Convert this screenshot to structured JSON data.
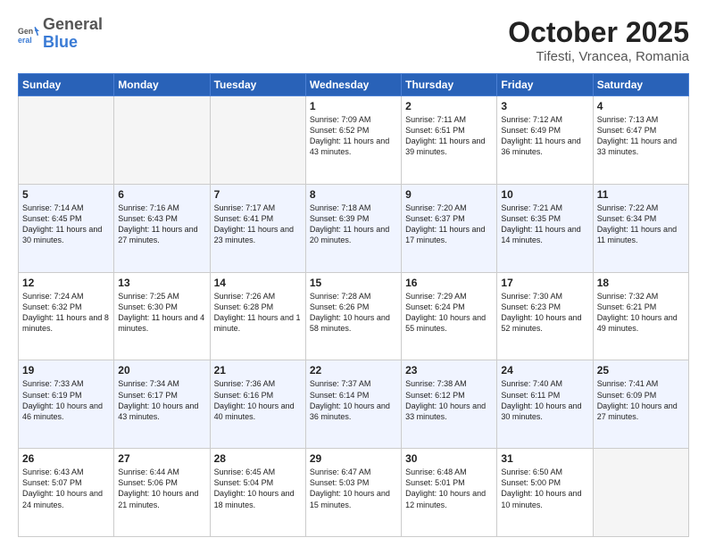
{
  "logo": {
    "general": "General",
    "blue": "Blue"
  },
  "header": {
    "month": "October 2025",
    "location": "Tifesti, Vrancea, Romania"
  },
  "weekdays": [
    "Sunday",
    "Monday",
    "Tuesday",
    "Wednesday",
    "Thursday",
    "Friday",
    "Saturday"
  ],
  "weeks": [
    [
      {
        "day": "",
        "info": ""
      },
      {
        "day": "",
        "info": ""
      },
      {
        "day": "",
        "info": ""
      },
      {
        "day": "1",
        "info": "Sunrise: 7:09 AM\nSunset: 6:52 PM\nDaylight: 11 hours and 43 minutes."
      },
      {
        "day": "2",
        "info": "Sunrise: 7:11 AM\nSunset: 6:51 PM\nDaylight: 11 hours and 39 minutes."
      },
      {
        "day": "3",
        "info": "Sunrise: 7:12 AM\nSunset: 6:49 PM\nDaylight: 11 hours and 36 minutes."
      },
      {
        "day": "4",
        "info": "Sunrise: 7:13 AM\nSunset: 6:47 PM\nDaylight: 11 hours and 33 minutes."
      }
    ],
    [
      {
        "day": "5",
        "info": "Sunrise: 7:14 AM\nSunset: 6:45 PM\nDaylight: 11 hours and 30 minutes."
      },
      {
        "day": "6",
        "info": "Sunrise: 7:16 AM\nSunset: 6:43 PM\nDaylight: 11 hours and 27 minutes."
      },
      {
        "day": "7",
        "info": "Sunrise: 7:17 AM\nSunset: 6:41 PM\nDaylight: 11 hours and 23 minutes."
      },
      {
        "day": "8",
        "info": "Sunrise: 7:18 AM\nSunset: 6:39 PM\nDaylight: 11 hours and 20 minutes."
      },
      {
        "day": "9",
        "info": "Sunrise: 7:20 AM\nSunset: 6:37 PM\nDaylight: 11 hours and 17 minutes."
      },
      {
        "day": "10",
        "info": "Sunrise: 7:21 AM\nSunset: 6:35 PM\nDaylight: 11 hours and 14 minutes."
      },
      {
        "day": "11",
        "info": "Sunrise: 7:22 AM\nSunset: 6:34 PM\nDaylight: 11 hours and 11 minutes."
      }
    ],
    [
      {
        "day": "12",
        "info": "Sunrise: 7:24 AM\nSunset: 6:32 PM\nDaylight: 11 hours and 8 minutes."
      },
      {
        "day": "13",
        "info": "Sunrise: 7:25 AM\nSunset: 6:30 PM\nDaylight: 11 hours and 4 minutes."
      },
      {
        "day": "14",
        "info": "Sunrise: 7:26 AM\nSunset: 6:28 PM\nDaylight: 11 hours and 1 minute."
      },
      {
        "day": "15",
        "info": "Sunrise: 7:28 AM\nSunset: 6:26 PM\nDaylight: 10 hours and 58 minutes."
      },
      {
        "day": "16",
        "info": "Sunrise: 7:29 AM\nSunset: 6:24 PM\nDaylight: 10 hours and 55 minutes."
      },
      {
        "day": "17",
        "info": "Sunrise: 7:30 AM\nSunset: 6:23 PM\nDaylight: 10 hours and 52 minutes."
      },
      {
        "day": "18",
        "info": "Sunrise: 7:32 AM\nSunset: 6:21 PM\nDaylight: 10 hours and 49 minutes."
      }
    ],
    [
      {
        "day": "19",
        "info": "Sunrise: 7:33 AM\nSunset: 6:19 PM\nDaylight: 10 hours and 46 minutes."
      },
      {
        "day": "20",
        "info": "Sunrise: 7:34 AM\nSunset: 6:17 PM\nDaylight: 10 hours and 43 minutes."
      },
      {
        "day": "21",
        "info": "Sunrise: 7:36 AM\nSunset: 6:16 PM\nDaylight: 10 hours and 40 minutes."
      },
      {
        "day": "22",
        "info": "Sunrise: 7:37 AM\nSunset: 6:14 PM\nDaylight: 10 hours and 36 minutes."
      },
      {
        "day": "23",
        "info": "Sunrise: 7:38 AM\nSunset: 6:12 PM\nDaylight: 10 hours and 33 minutes."
      },
      {
        "day": "24",
        "info": "Sunrise: 7:40 AM\nSunset: 6:11 PM\nDaylight: 10 hours and 30 minutes."
      },
      {
        "day": "25",
        "info": "Sunrise: 7:41 AM\nSunset: 6:09 PM\nDaylight: 10 hours and 27 minutes."
      }
    ],
    [
      {
        "day": "26",
        "info": "Sunrise: 6:43 AM\nSunset: 5:07 PM\nDaylight: 10 hours and 24 minutes."
      },
      {
        "day": "27",
        "info": "Sunrise: 6:44 AM\nSunset: 5:06 PM\nDaylight: 10 hours and 21 minutes."
      },
      {
        "day": "28",
        "info": "Sunrise: 6:45 AM\nSunset: 5:04 PM\nDaylight: 10 hours and 18 minutes."
      },
      {
        "day": "29",
        "info": "Sunrise: 6:47 AM\nSunset: 5:03 PM\nDaylight: 10 hours and 15 minutes."
      },
      {
        "day": "30",
        "info": "Sunrise: 6:48 AM\nSunset: 5:01 PM\nDaylight: 10 hours and 12 minutes."
      },
      {
        "day": "31",
        "info": "Sunrise: 6:50 AM\nSunset: 5:00 PM\nDaylight: 10 hours and 10 minutes."
      },
      {
        "day": "",
        "info": ""
      }
    ]
  ]
}
